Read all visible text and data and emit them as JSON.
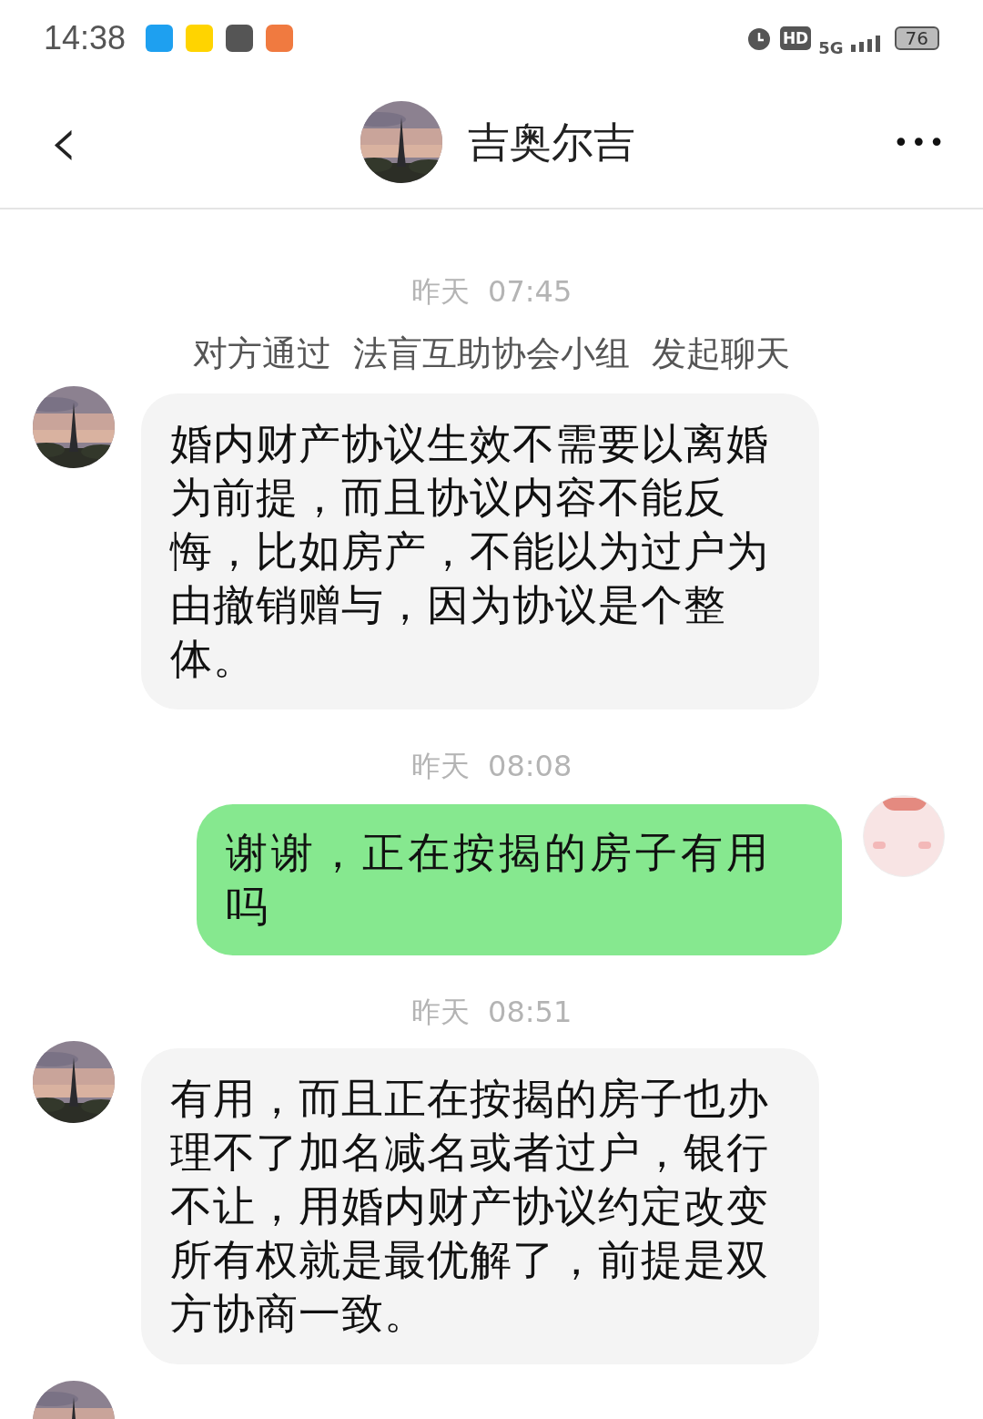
{
  "status_bar": {
    "time": "14:38",
    "hd": "HD",
    "network": "5G",
    "battery": "76"
  },
  "header": {
    "back": "‹",
    "title": "吉奥尔吉",
    "more": "•••"
  },
  "messages": [
    {
      "kind": "time",
      "text": "昨天  07:45"
    },
    {
      "kind": "system",
      "text": "对方通过  法盲互助协会小组  发起聊天"
    },
    {
      "kind": "incoming",
      "text": "婚内财产协议生效不需要以离婚为前提，而且协议内容不能反悔，比如房产，不能以为过户为由撤销赠与，因为协议是个整体。"
    },
    {
      "kind": "time",
      "text": "昨天  08:08"
    },
    {
      "kind": "outgoing",
      "text": "谢谢，正在按揭的房子有用吗"
    },
    {
      "kind": "time",
      "text": "昨天  08:51"
    },
    {
      "kind": "incoming",
      "text": "有用，而且正在按揭的房子也办理不了加名减名或者过户，银行不让，用婚内财产协议约定改变所有权就是最优解了，前提是双方协商一致。"
    }
  ]
}
